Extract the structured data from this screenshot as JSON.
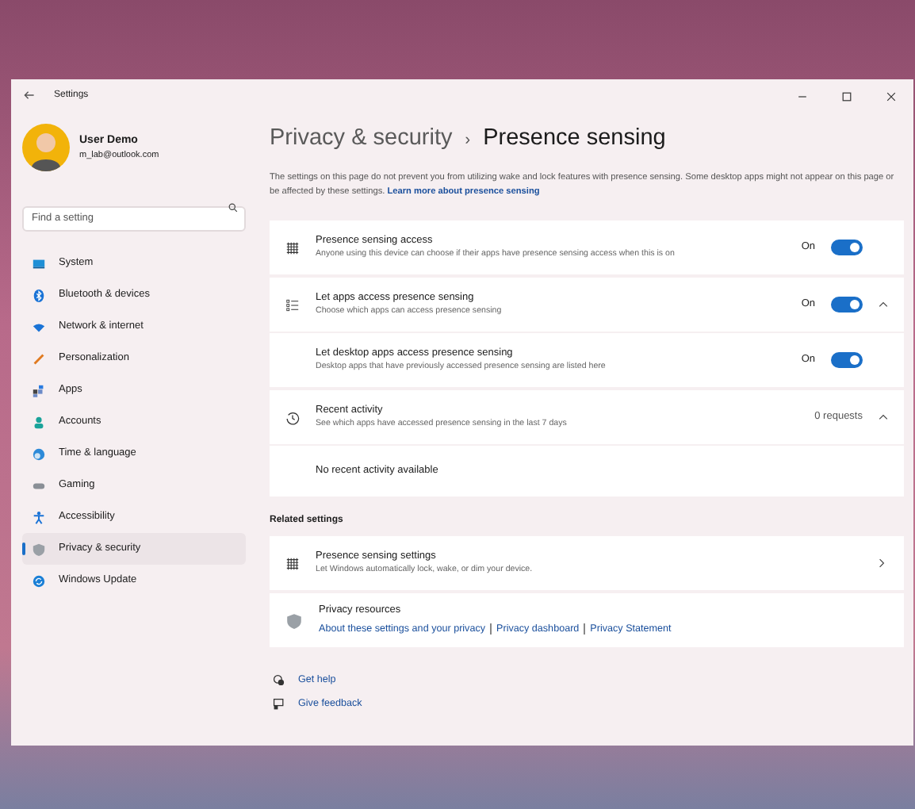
{
  "window": {
    "title": "Settings"
  },
  "user": {
    "name": "User Demo",
    "email": "m_lab@outlook.com"
  },
  "search": {
    "placeholder": "Find a setting"
  },
  "sidebar": {
    "items": [
      {
        "label": "System",
        "selected": false
      },
      {
        "label": "Bluetooth & devices",
        "selected": false
      },
      {
        "label": "Network & internet",
        "selected": false
      },
      {
        "label": "Personalization",
        "selected": false
      },
      {
        "label": "Apps",
        "selected": false
      },
      {
        "label": "Accounts",
        "selected": false
      },
      {
        "label": "Time & language",
        "selected": false
      },
      {
        "label": "Gaming",
        "selected": false
      },
      {
        "label": "Accessibility",
        "selected": false
      },
      {
        "label": "Privacy & security",
        "selected": true
      },
      {
        "label": "Windows Update",
        "selected": false
      }
    ]
  },
  "breadcrumb": {
    "parent": "Privacy & security",
    "separator": "›",
    "current": "Presence sensing"
  },
  "intro": {
    "text": "The settings on this page do not prevent you from utilizing wake and lock features with presence sensing. Some desktop apps might not appear on this page or be affected by these settings.",
    "link": "Learn more about presence sensing"
  },
  "settings": [
    {
      "kind": "toggle",
      "title": "Presence sensing access",
      "subtitle": "Anyone using this device can choose if their apps have presence sensing access when this is on",
      "state_label": "On",
      "on": true
    },
    {
      "kind": "toggle",
      "title": "Let apps access presence sensing",
      "subtitle": "Choose which apps can access presence sensing",
      "state_label": "On",
      "on": true,
      "expanded": true
    },
    {
      "kind": "subtoggle",
      "title": "Let desktop apps access presence sensing",
      "subtitle": "Desktop apps that have previously accessed presence sensing are listed here",
      "state_label": "On",
      "on": true
    },
    {
      "kind": "info",
      "title": "Recent activity",
      "subtitle": "See which apps have accessed presence sensing in the last 7 days",
      "state_label": "0 requests",
      "expanded": true
    },
    {
      "kind": "note",
      "title": "No recent activity available"
    }
  ],
  "related": {
    "heading": "Related settings",
    "items": [
      {
        "kind": "nav",
        "title": "Presence sensing settings",
        "subtitle": "Let Windows automatically lock, wake, or dim your device."
      },
      {
        "kind": "links",
        "title": "Privacy resources",
        "links": [
          "About these settings and your privacy",
          "Privacy dashboard",
          "Privacy Statement"
        ]
      }
    ]
  },
  "footer_links": [
    {
      "label": "Get help"
    },
    {
      "label": "Give feedback"
    }
  ]
}
